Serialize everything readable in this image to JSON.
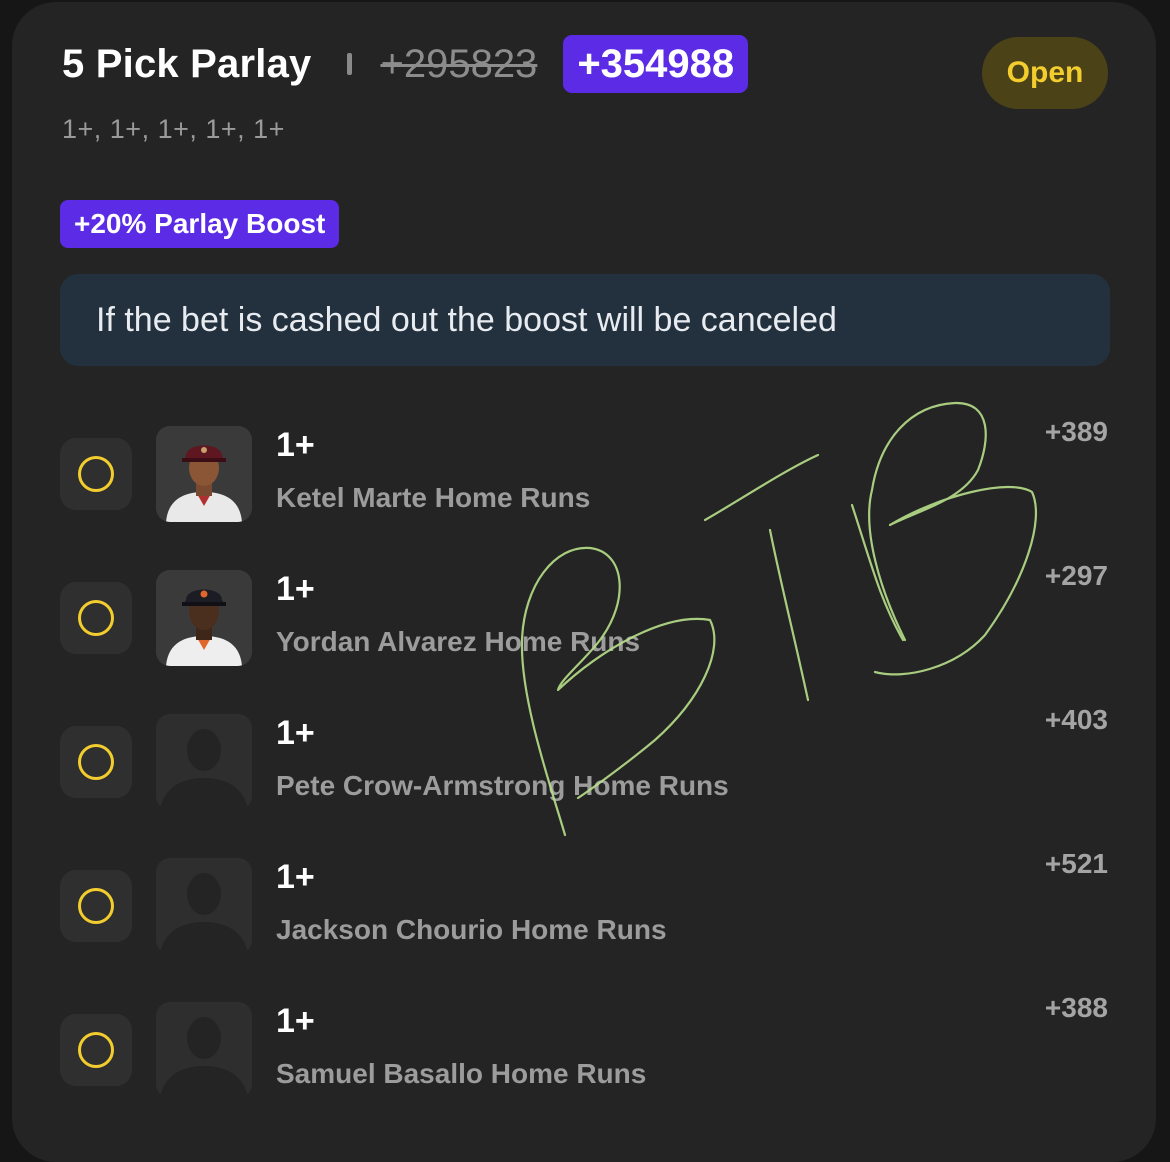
{
  "bet": {
    "title": "5 Pick Parlay",
    "original_odds": "+295823",
    "boosted_odds": "+354988",
    "status": "Open",
    "legs_summary": "1+, 1+, 1+, 1+, 1+",
    "boost_label": "+20% Parlay Boost",
    "notice": "If the bet is cashed out the boost will be canceled"
  },
  "legs": [
    {
      "line": "1+",
      "market": "Ketel Marte Home Runs",
      "odds": "+389",
      "avatar": "player-photo-diamondbacks"
    },
    {
      "line": "1+",
      "market": "Yordan Alvarez Home Runs",
      "odds": "+297",
      "avatar": "player-photo-astros"
    },
    {
      "line": "1+",
      "market": "Pete Crow-Armstrong Home Runs",
      "odds": "+403",
      "avatar": "silhouette-placeholder"
    },
    {
      "line": "1+",
      "market": "Jackson Chourio Home Runs",
      "odds": "+521",
      "avatar": "silhouette-placeholder"
    },
    {
      "line": "1+",
      "market": "Samuel Basallo Home Runs",
      "odds": "+388",
      "avatar": "silhouette-placeholder"
    }
  ],
  "watermark": {
    "text": "BTB",
    "color": "#b8e08a"
  },
  "colors": {
    "background": "#161616",
    "card": "#242424",
    "accent_purple": "#5b2be6",
    "status_yellow": "#f3cd2e",
    "notice_bg": "#23313f"
  }
}
